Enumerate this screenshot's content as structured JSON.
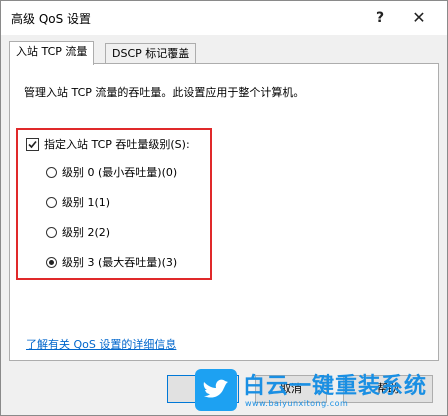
{
  "window": {
    "title": "高级 QoS 设置",
    "help_glyph": "?",
    "close_glyph": "✕"
  },
  "tabs": [
    {
      "label": "入站 TCP 流量",
      "active": true
    },
    {
      "label": "DSCP 标记覆盖",
      "active": false
    }
  ],
  "panel": {
    "description": "管理入站 TCP 流量的吞吐量。此设置应用于整个计算机。",
    "checkbox_label": "指定入站 TCP 吞吐量级别(S):",
    "checkbox_checked": true,
    "radios": [
      {
        "label": "级别 0 (最小吞吐量)(0)",
        "selected": false
      },
      {
        "label": "级别 1(1)",
        "selected": false
      },
      {
        "label": "级别 2(2)",
        "selected": false
      },
      {
        "label": "级别 3 (最大吞吐量)(3)",
        "selected": true
      }
    ],
    "info_link": "了解有关 QoS 设置的详细信息"
  },
  "buttons": {
    "ok": "",
    "cancel": "取消",
    "help": "帮助"
  },
  "watermark": {
    "title": "白云一键重装系统",
    "url": "www.baiyunxitong.com"
  },
  "colors": {
    "highlight": "#e0292a",
    "link": "#0066cc",
    "watermark": "#1a8fe3"
  }
}
